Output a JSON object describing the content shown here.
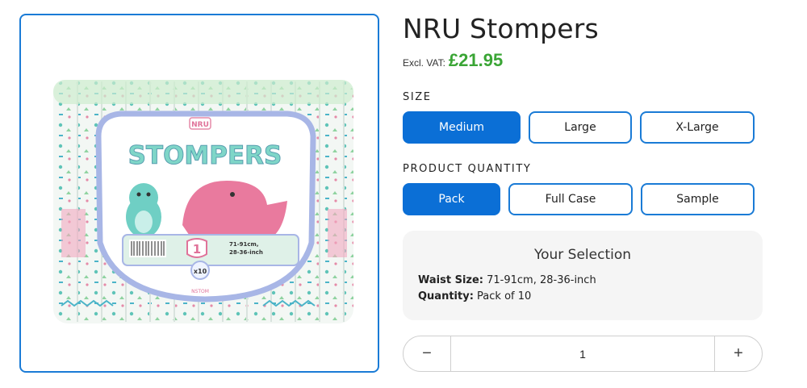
{
  "product": {
    "title": "NRU Stompers",
    "vat_label": "Excl. VAT:",
    "price": "£21.95",
    "price_color": "#3aa535",
    "accent_color": "#0b6fd6"
  },
  "image": {
    "brand_badge": "NRU",
    "brand_name": "STOMPERS",
    "size_number": "1",
    "size_text_line1": "71-91cm,",
    "size_text_line2": "28-36-inch",
    "count": "x10",
    "sku": "NSTOM"
  },
  "size": {
    "label": "SIZE",
    "options": [
      "Medium",
      "Large",
      "X-Large"
    ],
    "selected": "Medium"
  },
  "quantity_options": {
    "label": "PRODUCT QUANTITY",
    "options": [
      "Pack",
      "Full Case",
      "Sample"
    ],
    "selected": "Pack"
  },
  "selection": {
    "title": "Your Selection",
    "waist_label": "Waist Size:",
    "waist_value": "71-91cm, 28-36-inch",
    "quantity_label": "Quantity:",
    "quantity_value": "Pack of 10"
  },
  "stepper": {
    "minus": "−",
    "value": "1",
    "plus": "+"
  }
}
